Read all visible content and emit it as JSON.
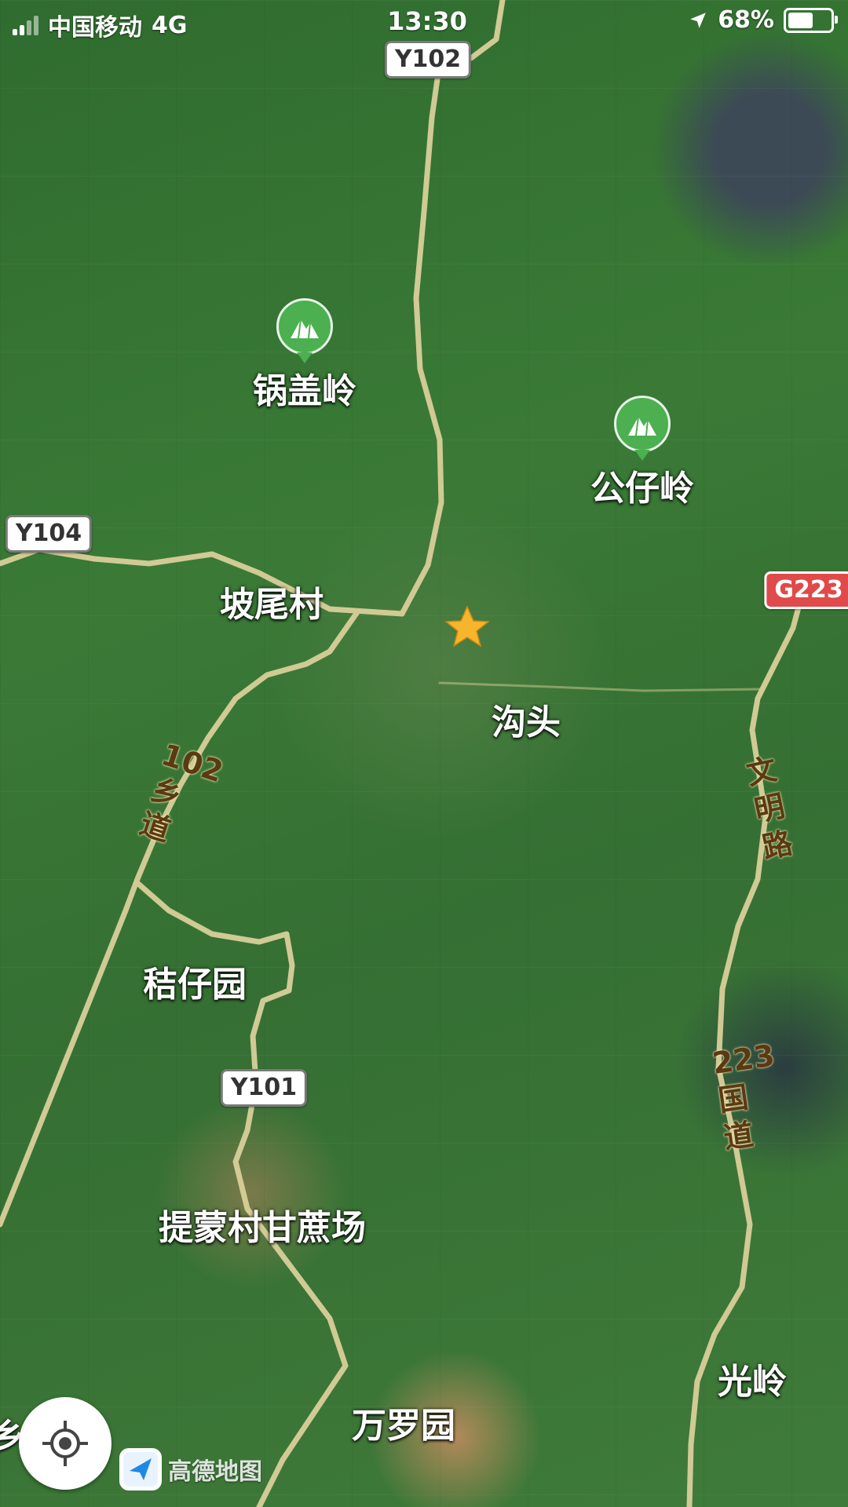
{
  "status_bar": {
    "carrier": "中国移动",
    "network": "4G",
    "time": "13:30",
    "battery_percent": "68%",
    "battery_level": 0.68
  },
  "map": {
    "road_shields": {
      "y102": "Y102",
      "y104": "Y104",
      "g223": "G223",
      "y101": "Y101"
    },
    "place_labels": {
      "guogailing": "锅盖岭",
      "gongzailing": "公仔岭",
      "poweicun": "坡尾村",
      "goutou": "沟头",
      "jiezaiyuan": "秸仔园",
      "timengcun": "提蒙村甘蔗场",
      "guangling": "光岭",
      "wanluoyuan": "万罗园",
      "edge_partial": "乡"
    },
    "road_labels": {
      "rural_102": "102乡道",
      "wenming": "文明路",
      "national_223": "223国道"
    },
    "poi_icons": [
      "mountain-icon",
      "mountain-icon"
    ],
    "marker_icon": "star-icon",
    "colors": {
      "road": "#d9cf9a",
      "poi": "#4caf50",
      "national_shield": "#e04a4a",
      "marker": "#f7b52c"
    }
  },
  "controls": {
    "locate_icon": "locate-crosshair-icon"
  },
  "logo": {
    "text": "高德地图",
    "icon": "navigation-arrow-icon"
  }
}
